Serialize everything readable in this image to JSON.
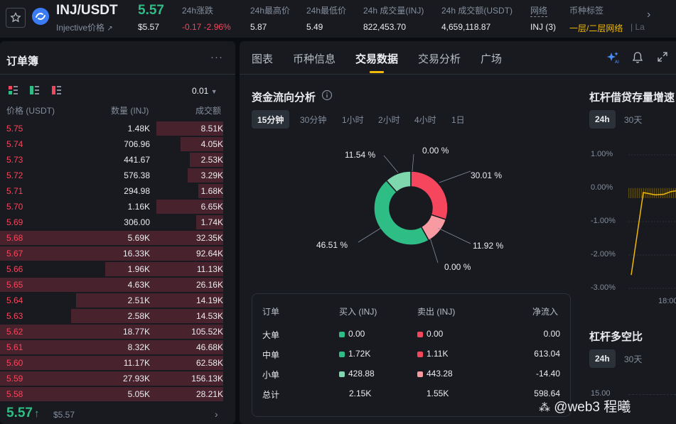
{
  "header": {
    "pair": "INJ/USDT",
    "pair_sub": "Injective价格",
    "pair_sub_arrow": "↗",
    "price": "5.57",
    "price_usd": "$5.57",
    "stats": [
      {
        "label": "24h涨跌",
        "value": "-0.17 -2.96%"
      },
      {
        "label": "24h最高价",
        "value": "5.87"
      },
      {
        "label": "24h最低价",
        "value": "5.49"
      },
      {
        "label": "24h 成交量(INJ)",
        "value": "822,453.70"
      },
      {
        "label": "24h 成交额(USDT)",
        "value": "4,659,118.87"
      },
      {
        "label": "网络",
        "value": "INJ (3)"
      },
      {
        "label": "币种标签",
        "value": "一层/二层网络"
      },
      {
        "label": "",
        "value": "| La"
      }
    ],
    "colors": {
      "up": "#2ebd85",
      "down": "#f6465d",
      "accent": "#f0b90b"
    }
  },
  "orderbook": {
    "title": "订单簿",
    "more": "···",
    "precision": "0.01",
    "columns": [
      "价格 (USDT)",
      "数量 (INJ)",
      "成交额"
    ],
    "rows": [
      {
        "price": "5.75",
        "qty": "1.48K",
        "total": "8.51K",
        "depth": 0.3,
        "mid": 0.0
      },
      {
        "price": "5.74",
        "qty": "706.96",
        "total": "4.05K",
        "depth": 0.19,
        "mid": 0.0
      },
      {
        "price": "5.73",
        "qty": "441.67",
        "total": "2.53K",
        "depth": 0.15,
        "mid": 0.0
      },
      {
        "price": "5.72",
        "qty": "576.38",
        "total": "3.29K",
        "depth": 0.16,
        "mid": 0.0
      },
      {
        "price": "5.71",
        "qty": "294.98",
        "total": "1.68K",
        "depth": 0.11,
        "mid": 0.0
      },
      {
        "price": "5.70",
        "qty": "1.16K",
        "total": "6.65K",
        "depth": 0.3,
        "mid": 0.0
      },
      {
        "price": "5.69",
        "qty": "306.00",
        "total": "1.74K",
        "depth": 0.12,
        "mid": 0.0
      },
      {
        "price": "5.68",
        "qty": "5.69K",
        "total": "32.35K",
        "depth": 1.0,
        "mid": 0.0
      },
      {
        "price": "5.67",
        "qty": "16.33K",
        "total": "92.64K",
        "depth": 1.0,
        "mid": 0.0
      },
      {
        "price": "5.66",
        "qty": "1.96K",
        "total": "11.13K",
        "depth": 1.0,
        "mid": 0.47
      },
      {
        "price": "5.65",
        "qty": "4.63K",
        "total": "26.16K",
        "depth": 1.0,
        "mid": 0.0
      },
      {
        "price": "5.64",
        "qty": "2.51K",
        "total": "14.19K",
        "depth": 1.0,
        "mid": 0.34
      },
      {
        "price": "5.63",
        "qty": "2.58K",
        "total": "14.53K",
        "depth": 1.0,
        "mid": 0.32
      },
      {
        "price": "5.62",
        "qty": "18.77K",
        "total": "105.52K",
        "depth": 1.0,
        "mid": 0.0
      },
      {
        "price": "5.61",
        "qty": "8.32K",
        "total": "46.68K",
        "depth": 1.0,
        "mid": 0.0
      },
      {
        "price": "5.60",
        "qty": "11.17K",
        "total": "62.58K",
        "depth": 1.0,
        "mid": 0.0
      },
      {
        "price": "5.59",
        "qty": "27.93K",
        "total": "156.13K",
        "depth": 1.0,
        "mid": 0.0
      },
      {
        "price": "5.58",
        "qty": "5.05K",
        "total": "28.21K",
        "depth": 1.0,
        "mid": 0.0
      }
    ],
    "last_price": "5.57",
    "last_arrow": "↑",
    "last_usd": "$5.57"
  },
  "tabs": [
    "图表",
    "币种信息",
    "交易数据",
    "交易分析",
    "广场"
  ],
  "active_tab": "交易数据",
  "fund_flow": {
    "title": "资金流向分析",
    "periods": [
      "15分钟",
      "30分钟",
      "1小时",
      "2小时",
      "4小时",
      "1日"
    ],
    "active_period": "15分钟",
    "labels": {
      "top": "0.00 %",
      "sell_mid": "30.01 %",
      "sell_small": "11.92 %",
      "bottom": "0.00 %",
      "buy_mid": "46.51 %",
      "buy_small": "11.54 %"
    },
    "table": {
      "headers": [
        "订单",
        "买入 (INJ)",
        "卖出 (INJ)",
        "净流入"
      ],
      "rows": [
        {
          "name": "大单",
          "buy": "0.00",
          "sell": "0.00",
          "net": "0.00"
        },
        {
          "name": "中单",
          "buy": "1.72K",
          "sell": "1.11K",
          "net": "613.04"
        },
        {
          "name": "小单",
          "buy": "428.88",
          "sell": "443.28",
          "net": "-14.40"
        },
        {
          "name": "总计",
          "buy": "2.15K",
          "sell": "1.55K",
          "net": "598.64"
        }
      ]
    }
  },
  "chart_data": [
    {
      "type": "pie",
      "categories": [
        "卖出 大单",
        "卖出 中单",
        "卖出 小单",
        "买入 大单",
        "买入 中单",
        "买入 小单"
      ],
      "values": [
        0.0,
        30.01,
        11.92,
        0.0,
        46.51,
        11.54
      ],
      "colors": [
        "#f6465d",
        "#f6465d",
        "#f89aa2",
        "#2ebd85",
        "#2ebd85",
        "#7fd7ad"
      ],
      "title": "资金流向分析"
    },
    {
      "type": "line",
      "title": "杠杆借贷存量增速",
      "periods": [
        "24h",
        "30天"
      ],
      "active_period": "24h",
      "yticks": [
        "1.00%",
        "0.00%",
        "-1.00%",
        "-2.00%",
        "-3.00%"
      ],
      "ylim": [
        -3,
        1
      ],
      "xticks": [
        "18:00"
      ],
      "values": [
        -2.6,
        -0.13,
        -0.2,
        -0.18,
        -0.1,
        -0.08
      ],
      "color": "#f0b90b"
    },
    {
      "type": "line",
      "title": "杠杆多空比",
      "periods": [
        "24h",
        "30天"
      ],
      "active_period": "24h",
      "yticks": [
        "15.00"
      ]
    }
  ],
  "watermark": "@web3  程曦"
}
